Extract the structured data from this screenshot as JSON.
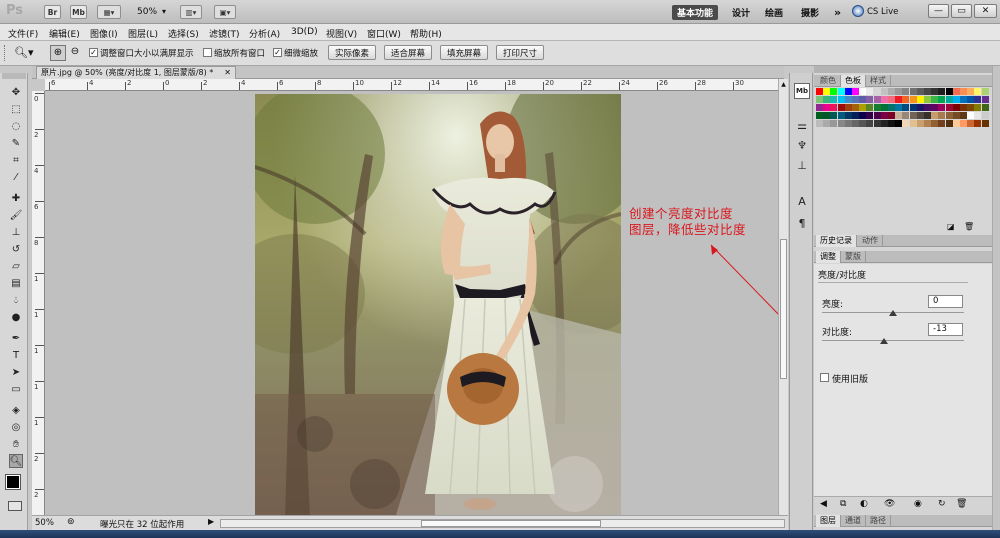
{
  "app": {
    "logo": "Ps",
    "chips": [
      "Br",
      "Mb"
    ],
    "zoom_select": "50%",
    "workspaces": [
      "基本功能",
      "设计",
      "绘画",
      "摄影"
    ],
    "more": "»",
    "cslive": "CS Live",
    "win_buttons": [
      "—",
      "▭",
      "✕"
    ]
  },
  "menu": [
    "文件(F)",
    "编辑(E)",
    "图像(I)",
    "图层(L)",
    "选择(S)",
    "滤镜(T)",
    "分析(A)",
    "3D(D)",
    "视图(V)",
    "窗口(W)",
    "帮助(H)"
  ],
  "options": {
    "check1": "调整窗口大小以满屏显示",
    "check2": "缩放所有窗口",
    "check3": "细微缩放",
    "btn_actual": "实际像素",
    "btn_fit": "适合屏幕",
    "btn_fill": "填充屏幕",
    "btn_print": "打印尺寸"
  },
  "document": {
    "tab_title": "原片.jpg @ 50% (亮度/对比度 1, 图层蒙版/8) *",
    "close": "✕"
  },
  "ruler": {
    "top_ticks": [
      "6",
      "4",
      "2",
      "0",
      "2",
      "4",
      "6",
      "8",
      "10",
      "12",
      "14",
      "16",
      "18",
      "20",
      "22",
      "24",
      "26",
      "28",
      "30"
    ],
    "left_ticks": [
      "0",
      "2",
      "4",
      "6",
      "8",
      "1",
      "1",
      "1",
      "1",
      "1",
      "2",
      "2"
    ]
  },
  "annotation": {
    "line1": "创建个亮度对比度",
    "line2": "图层，降低些对比度",
    "color": "#d9161d"
  },
  "status": {
    "zoom": "50%",
    "info": "曝光只在 32 位起作用"
  },
  "panels": {
    "swatch_tabs": [
      "颜色",
      "色板",
      "样式"
    ],
    "history_tabs": [
      "历史记录",
      "动作"
    ],
    "adjust_tabs": [
      "调整",
      "蒙版"
    ],
    "adjust_title": "亮度/对比度",
    "brightness_label": "亮度:",
    "brightness_value": "0",
    "brightness_level": 0.5,
    "contrast_label": "对比度:",
    "contrast_value": "-13",
    "contrast_level": 0.44,
    "legacy_label": "使用旧版",
    "layer_tabs": [
      "图层",
      "通道",
      "路径"
    ]
  },
  "swatch_colors": [
    "#ff0000",
    "#ffff00",
    "#00ff00",
    "#00ffff",
    "#0000ff",
    "#ff00ff",
    "#ffffff",
    "#ebebeb",
    "#d6d6d6",
    "#c2c2c2",
    "#adadad",
    "#999999",
    "#858585",
    "#707070",
    "#5c5c5c",
    "#474747",
    "#333333",
    "#1f1f1f",
    "#000000",
    "#f26c4f",
    "#f68e56",
    "#fbaf5d",
    "#fff568",
    "#acd373",
    "#7cc576",
    "#3bb878",
    "#1abbb4",
    "#00bff3",
    "#438ccb",
    "#5574b9",
    "#605ca8",
    "#855fa8",
    "#a763a8",
    "#f06ea9",
    "#f26d7d",
    "#ed1c24",
    "#f26522",
    "#f7941d",
    "#fff200",
    "#8dc63f",
    "#39b54a",
    "#00a651",
    "#00a99d",
    "#00aeef",
    "#0072bc",
    "#0054a6",
    "#2e3192",
    "#662d91",
    "#92278f",
    "#ec008c",
    "#ed145b",
    "#9e0b0f",
    "#a0410d",
    "#a36209",
    "#aba000",
    "#598527",
    "#197b30",
    "#007236",
    "#00746b",
    "#0076a3",
    "#004b80",
    "#003471",
    "#1b1464",
    "#440e62",
    "#630460",
    "#9e005d",
    "#9e0039",
    "#790000",
    "#7b2e00",
    "#7d4900",
    "#827b00",
    "#406618",
    "#005e20",
    "#005826",
    "#005952",
    "#005b7f",
    "#003663",
    "#002157",
    "#0d004c",
    "#32004b",
    "#4b0049",
    "#7b0046",
    "#7a0026",
    "#c7b299",
    "#998675",
    "#736357",
    "#534741",
    "#37302d",
    "#c69c6d",
    "#a67c52",
    "#8c6239",
    "#754c24",
    "#603913",
    "#ffffff",
    "#e6e6e6",
    "#cccccc",
    "#bbbbbb",
    "#aaaaaa",
    "#999999",
    "#888888",
    "#777777",
    "#666666",
    "#555555",
    "#444444",
    "#333333",
    "#222222",
    "#111111",
    "#000000",
    "#f0d6b6",
    "#e0c090",
    "#c8a070",
    "#b08050",
    "#906030",
    "#704020",
    "#503010",
    "#ffcc99",
    "#ff9966",
    "#cc6633",
    "#993300",
    "#663300"
  ]
}
